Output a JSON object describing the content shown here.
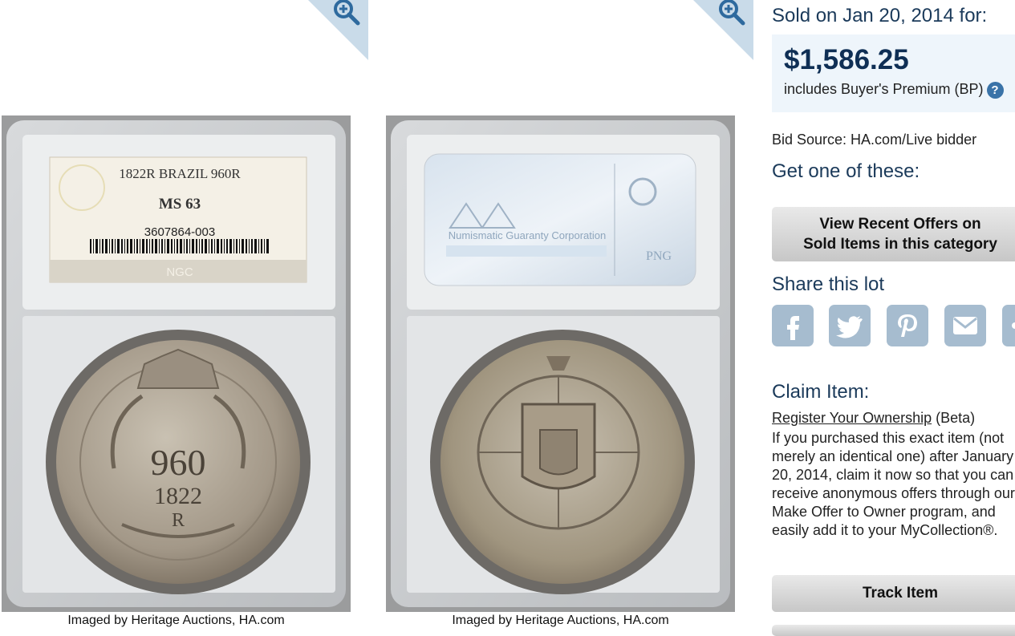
{
  "images": [
    {
      "caption": "Imaged by Heritage Auctions, HA.com"
    },
    {
      "caption": "Imaged by Heritage Auctions, HA.com"
    }
  ],
  "label": {
    "title": "1822R BRAZIL 960R",
    "grade": "MS 63",
    "cert": "3607864-003",
    "brand": "NGC"
  },
  "reverse_label": {
    "text": "Numismatic Guaranty Corporation",
    "png": "PNG"
  },
  "coin": {
    "denom": "960",
    "year": "1822",
    "mint": "R"
  },
  "sale": {
    "heading": "Sold on Jan 20, 2014 for:",
    "price": "$1,586.25",
    "bp_text": "includes Buyer's Premium (BP)",
    "help_symbol": "?",
    "bid_source": "Bid Source: HA.com/Live bidder"
  },
  "offers": {
    "heading": "Get one of these:",
    "line1": "View Recent Offers on",
    "line2": "Sold Items in this category"
  },
  "share": {
    "heading": "Share this lot",
    "icons": [
      "facebook-icon",
      "twitter-icon",
      "pinterest-icon",
      "email-icon",
      "link-icon"
    ]
  },
  "claim": {
    "heading": "Claim Item:",
    "link": "Register Your Ownership",
    "beta": " (Beta)",
    "text": "If you purchased this exact item (not merely an identical one) after January 20, 2014, claim it now so that you can receive anonymous offers through our Make Offer to Owner program, and easily add it to your MyCollection®."
  },
  "track": {
    "label": "Track Item"
  },
  "colors": {
    "heading": "#1b3a5a",
    "price": "#0f2f55",
    "price_bg": "#eef5fb",
    "share_icon": "#a6bccf",
    "zoom_corner": "#c9dbe9",
    "zoom_icon": "#2e6a9e"
  }
}
